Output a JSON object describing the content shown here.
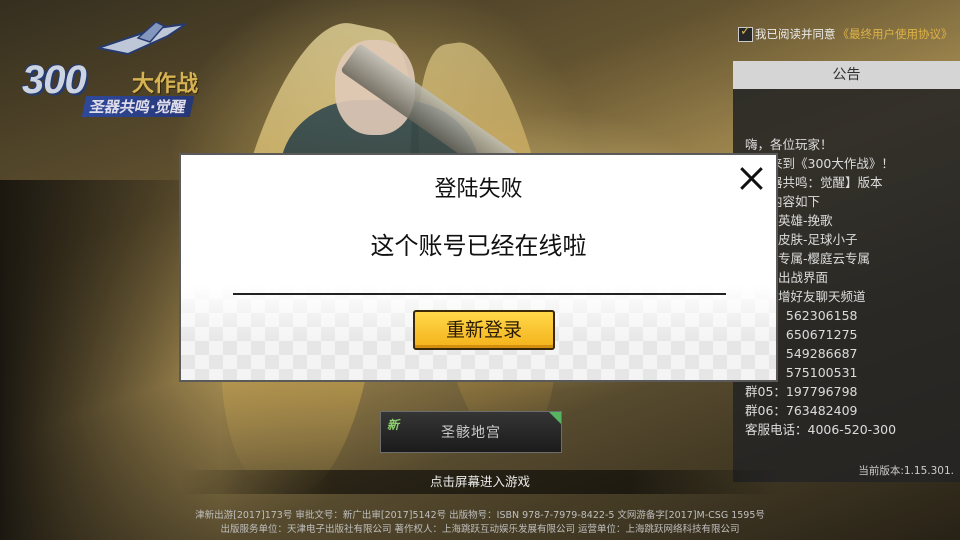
{
  "logo": {
    "number": "300",
    "title": "大作战",
    "subtitle": "圣器共鸣·觉醒"
  },
  "agreement": {
    "checked": true,
    "prefix": "我已阅读并同意",
    "link": "《最终用户使用协议》"
  },
  "notice": {
    "header": "公告",
    "lines": [
      "嗨，各位玩家！",
      "欢迎来到《300大作战》！",
      "【圣器共鸣：觉醒】版本",
      "更新内容如下",
      "1、新英雄-挽歌",
      "2、新皮肤-足球小子",
      "3、新专属-樱庭云专属",
      "4、新出战界面",
      "5、新增好友聊天频道",
      "群01：562306158",
      "群02：650671275",
      "群03：549286687",
      "群04：575100531",
      "群05：197796798",
      "群06：763482409",
      "客服电话：4006-520-300"
    ],
    "version": "当前版本:1.15.301."
  },
  "server": {
    "badge": "新",
    "name": "圣骸地宫"
  },
  "tap_to_enter": "点击屏幕进入游戏",
  "footer": {
    "line1": "津新出游[2017]173号  审批文号：新广出审[2017]5142号  出版物号：ISBN 978-7-7979-8422-5  文网游备字[2017]M-CSG 1595号",
    "line2": "出版服务单位：天津电子出版社有限公司  著作权人：上海跳跃互动娱乐发展有限公司  运营单位：上海跳跃网络科技有限公司"
  },
  "dialog": {
    "title": "登陆失败",
    "message": "这个账号已经在线啦",
    "button": "重新登录"
  }
}
